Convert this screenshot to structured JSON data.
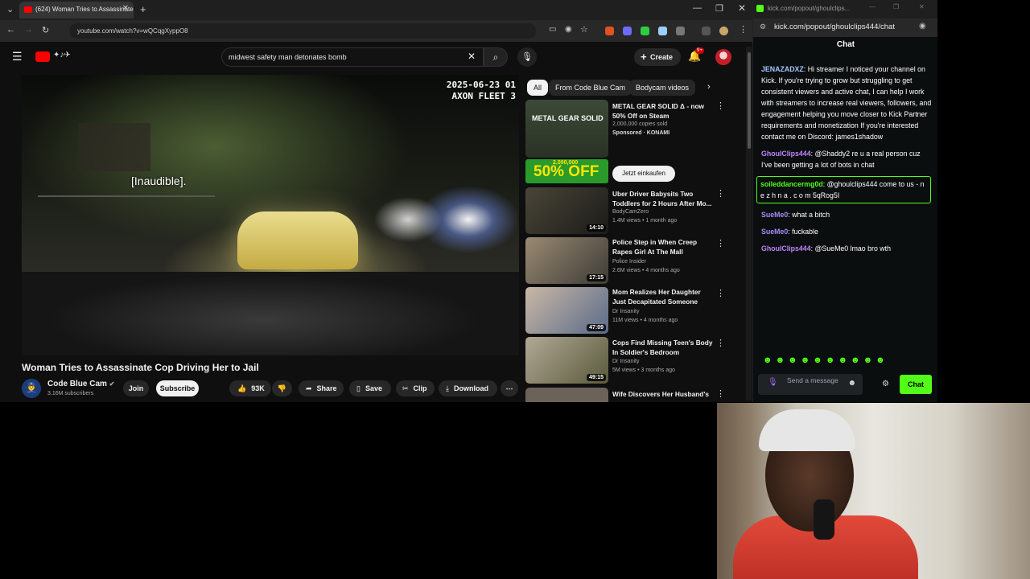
{
  "browser": {
    "tab_title": "(624) Woman Tries to Assassinate...",
    "url": "youtube.com/watch?v=wQCqgXyppO8"
  },
  "youtube": {
    "search_value": "midwest safety man detonates bomb",
    "create_label": "Create",
    "notif_count": "9+",
    "video": {
      "timestamp_line1": "2025-06-23 01",
      "timestamp_line2": "AXON FLEET 3",
      "caption": "[Inaudible].",
      "title": "Woman Tries to Assassinate Cop Driving Her to Jail"
    },
    "channel": {
      "name": "Code Blue Cam",
      "subscribers": "3.16M subscribers"
    },
    "actions": {
      "join": "Join",
      "subscribe": "Subscribe",
      "likes": "93K",
      "share": "Share",
      "save": "Save",
      "clip": "Clip",
      "download": "Download"
    },
    "chips": [
      "All",
      "From Code Blue Cam",
      "Bodycam videos"
    ],
    "ad": {
      "title": "METAL GEAR SOLID Δ - now 50% Off on Steam",
      "meta": "2,000,000 copies sold",
      "sponsored": "Sponsored",
      "advertiser": "KONAMI",
      "thumb_text": "METAL GEAR SOLID",
      "banner_small": "2,000,000",
      "banner_big": "50% OFF",
      "cta": "Jetzt einkaufen"
    },
    "recs": [
      {
        "title": "Uber Driver Babysits Two Toddlers for 2 Hours After Mo...",
        "channel": "BodyCamZero",
        "meta": "1.4M views • 1 month ago",
        "duration": "14:10"
      },
      {
        "title": "Police Step in When Creep Rapes Girl At The Mall",
        "channel": "Police Insider",
        "meta": "2.6M views • 4 months ago",
        "duration": "17:15"
      },
      {
        "title": "Mom Realizes Her Daughter Just Decapitated Someone",
        "channel": "Dr Insanity",
        "meta": "11M views • 4 months ago",
        "duration": "47:09"
      },
      {
        "title": "Cops Find Missing Teen's Body In Soldier's Bedroom",
        "channel": "Dr Insanity",
        "meta": "5M views • 3 months ago",
        "duration": "49:15"
      },
      {
        "title": "Wife Discovers Her Husband's",
        "channel": "",
        "meta": "",
        "duration": ""
      }
    ]
  },
  "kick": {
    "window_title": "kick.com/popout/ghoulclips...",
    "url": "kick.com/popout/ghoulclips444/chat",
    "header": "Chat",
    "messages": [
      {
        "user": "JENAZADXZ",
        "text": "Hi streamer I noticed your channel on Kick. If you're trying to grow but struggling to get consistent viewers and active chat, I can help I work with streamers to increase real viewers, followers, and engagement helping you move closer to Kick Partner requirements and monetization If you're interested contact me on Discord: james1shadow",
        "color": "#a5c8ff"
      },
      {
        "user": "GhoulClips444",
        "text": "@Shaddy2 re u a real person cuz I've been getting a lot of bots in chat",
        "color": "#c084fc"
      },
      {
        "user": "soileddancermg0d",
        "text": "@ghoulclips444 come to us - n e z h n a . c o m 5qRog5I",
        "color": "#53fc18"
      },
      {
        "user": "SueMe0",
        "text": "what a bitch",
        "color": "#a78bfa"
      },
      {
        "user": "SueMe0",
        "text": "fuckable",
        "color": "#a78bfa"
      },
      {
        "user": "GhoulClips444",
        "text": "@SueMe0 lmao bro wth",
        "color": "#c084fc"
      }
    ],
    "send_placeholder": "Send a message",
    "chat_button": "Chat"
  }
}
